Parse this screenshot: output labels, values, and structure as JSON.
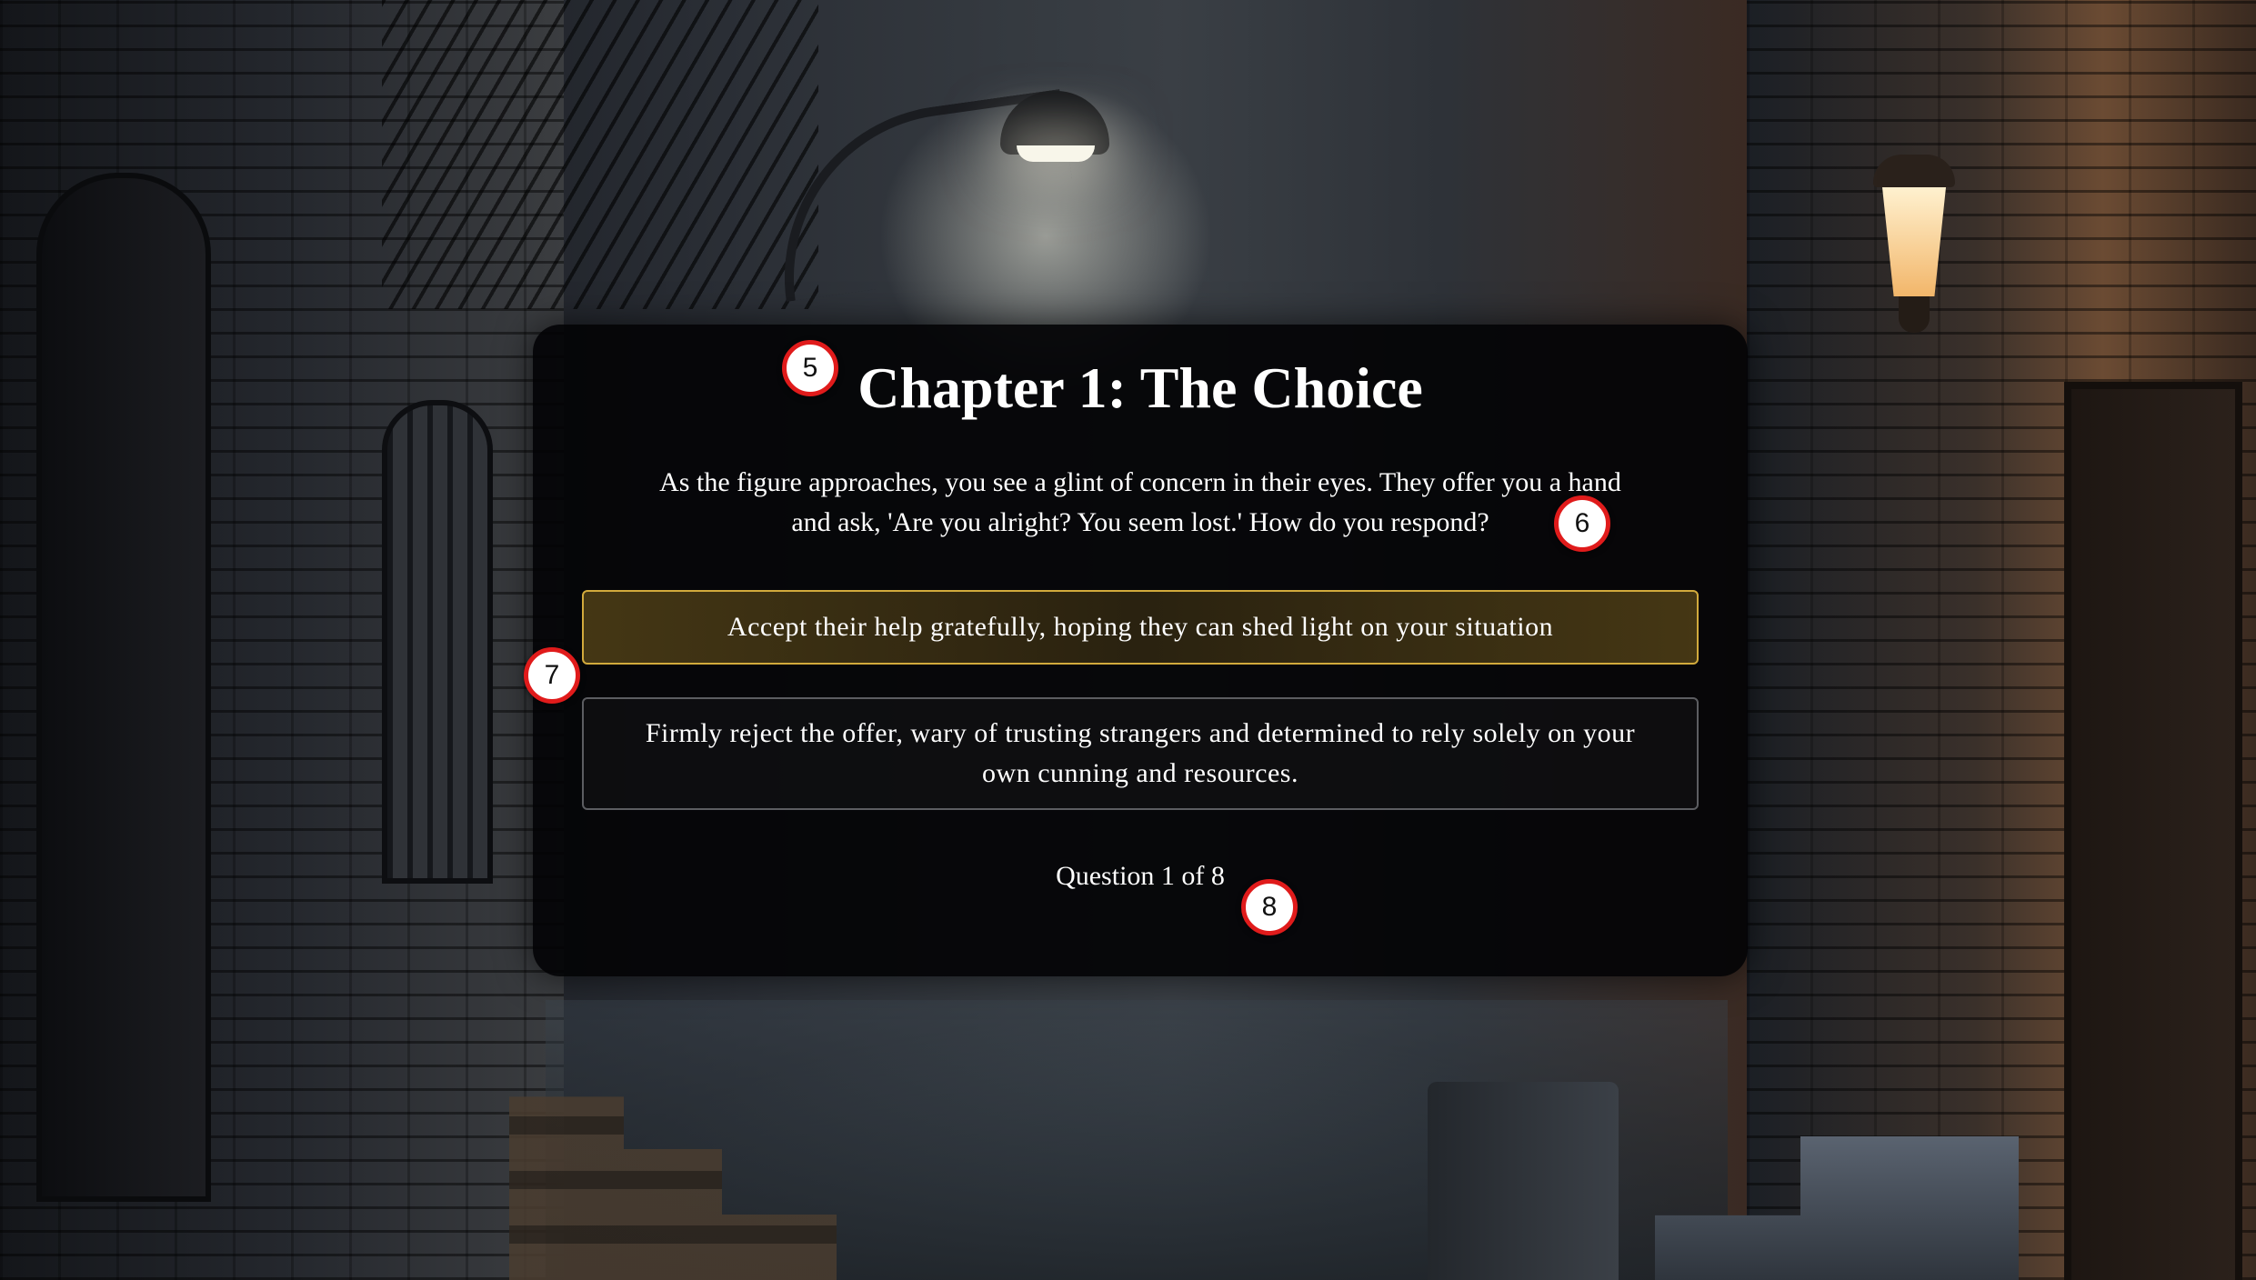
{
  "story": {
    "title": "Chapter 1: The Choice",
    "text": "As the figure approaches, you see a glint of concern in their eyes. They offer you a hand and ask, 'Are you alright? You seem lost.' How do you respond?",
    "choices": [
      {
        "label": "Accept their help gratefully, hoping they can shed light on your situation",
        "highlighted": true
      },
      {
        "label": "Firmly reject the offer, wary of trusting strangers and determined to rely solely on your own cunning and resources.",
        "highlighted": false
      }
    ],
    "progress": "Question 1 of 8"
  },
  "markers": [
    "5",
    "6",
    "7",
    "8"
  ],
  "colors": {
    "card_background": "#030305",
    "highlight_border": "#d2aa3c",
    "choice_border": "#5c5d61",
    "marker_border": "#e01b1b",
    "text": "#ffffff"
  },
  "background": {
    "icons": [
      "street-lamp-icon",
      "wall-lantern-icon",
      "trash-can-icon"
    ]
  }
}
